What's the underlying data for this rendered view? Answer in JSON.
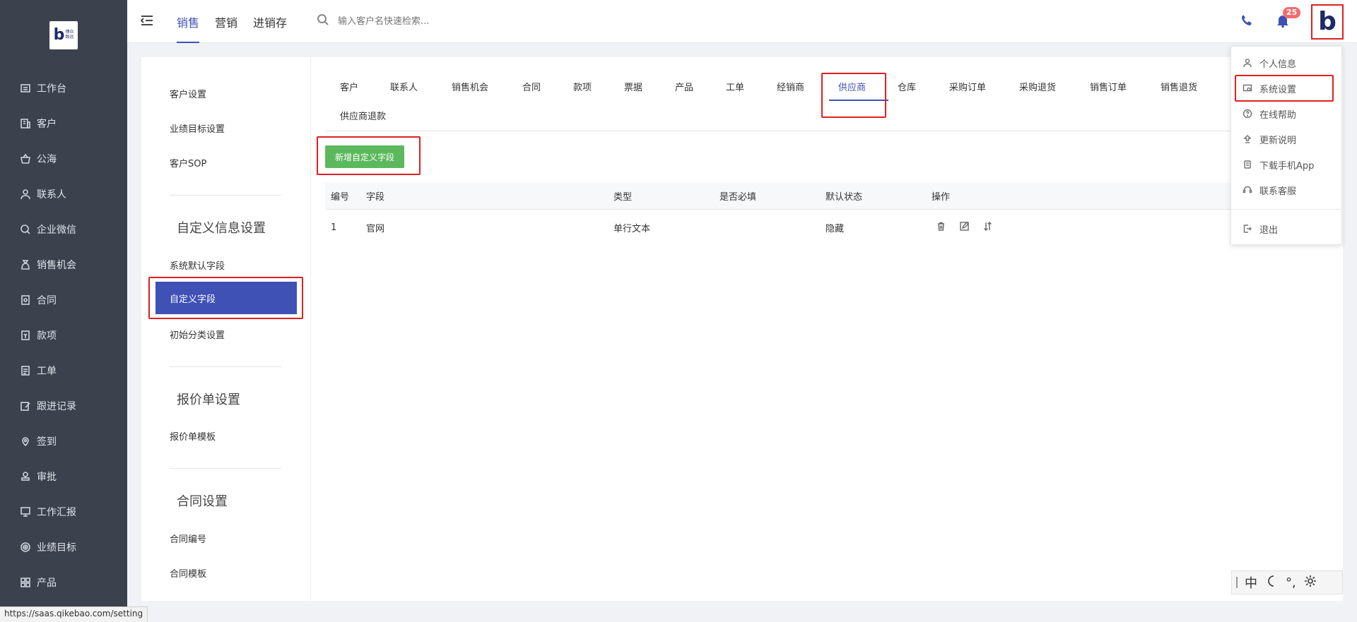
{
  "sidebar": {
    "logo_letter": "b",
    "logo_text_line1": "博众",
    "logo_text_line2": "致远",
    "items": [
      {
        "label": "工作台",
        "icon": "dashboard-icon"
      },
      {
        "label": "客户",
        "icon": "building-icon"
      },
      {
        "label": "公海",
        "icon": "basket-icon"
      },
      {
        "label": "联系人",
        "icon": "user-icon"
      },
      {
        "label": "企业微信",
        "icon": "chat-icon"
      },
      {
        "label": "销售机会",
        "icon": "money-bag-icon"
      },
      {
        "label": "合同",
        "icon": "contract-icon"
      },
      {
        "label": "款项",
        "icon": "payment-icon"
      },
      {
        "label": "工单",
        "icon": "clipboard-icon"
      },
      {
        "label": "跟进记录",
        "icon": "edit-icon"
      },
      {
        "label": "签到",
        "icon": "location-icon"
      },
      {
        "label": "审批",
        "icon": "stamp-icon"
      },
      {
        "label": "工作汇报",
        "icon": "report-icon"
      },
      {
        "label": "业绩目标",
        "icon": "target-icon"
      },
      {
        "label": "产品",
        "icon": "grid-icon"
      }
    ]
  },
  "header": {
    "tabs": [
      "销售",
      "营销",
      "进销存"
    ],
    "active_tab": "销售",
    "search_placeholder": "输入客户名快速检索...",
    "notification_count": "25",
    "avatar_letter": "b"
  },
  "settings_nav": {
    "items_top": [
      "客户设置",
      "业绩目标设置",
      "客户SOP"
    ],
    "section_custom": "自定义信息设置",
    "custom_items": [
      "系统默认字段",
      "自定义字段",
      "初始分类设置"
    ],
    "active_item": "自定义字段",
    "section_quote": "报价单设置",
    "quote_items": [
      "报价单模板"
    ],
    "section_contract": "合同设置",
    "contract_items": [
      "合同编号",
      "合同模板"
    ]
  },
  "subtabs": {
    "items": [
      "客户",
      "联系人",
      "销售机会",
      "合同",
      "款项",
      "票据",
      "产品",
      "工单",
      "经销商",
      "供应商",
      "仓库",
      "采购订单",
      "采购退货",
      "销售订单",
      "销售退货",
      "供应商退款"
    ],
    "active": "供应商"
  },
  "actions": {
    "add_button": "新增自定义字段"
  },
  "table": {
    "headers": [
      "编号",
      "字段",
      "类型",
      "是否必填",
      "默认状态",
      "操作"
    ],
    "rows": [
      {
        "id": "1",
        "field": "官网",
        "type": "单行文本",
        "required": "",
        "status": "隐藏"
      }
    ]
  },
  "dropdown": {
    "items": [
      {
        "label": "个人信息",
        "icon": "user-icon"
      },
      {
        "label": "系统设置",
        "icon": "settings-icon"
      },
      {
        "label": "在线帮助",
        "icon": "help-icon"
      },
      {
        "label": "更新说明",
        "icon": "upload-icon"
      },
      {
        "label": "下载手机App",
        "icon": "mobile-icon"
      },
      {
        "label": "联系客服",
        "icon": "headset-icon"
      },
      {
        "label": "退出",
        "icon": "logout-icon"
      }
    ]
  },
  "ime_toolbar": {
    "lang": "中",
    "punct": "°,"
  },
  "status_url": "https://saas.qikebao.com/setting",
  "colors": {
    "sidebar_bg": "#3b414d",
    "accent": "#3f51b5",
    "add_button": "#5cb85c",
    "highlight_box": "#e0201e",
    "badge": "#f56c6c"
  }
}
